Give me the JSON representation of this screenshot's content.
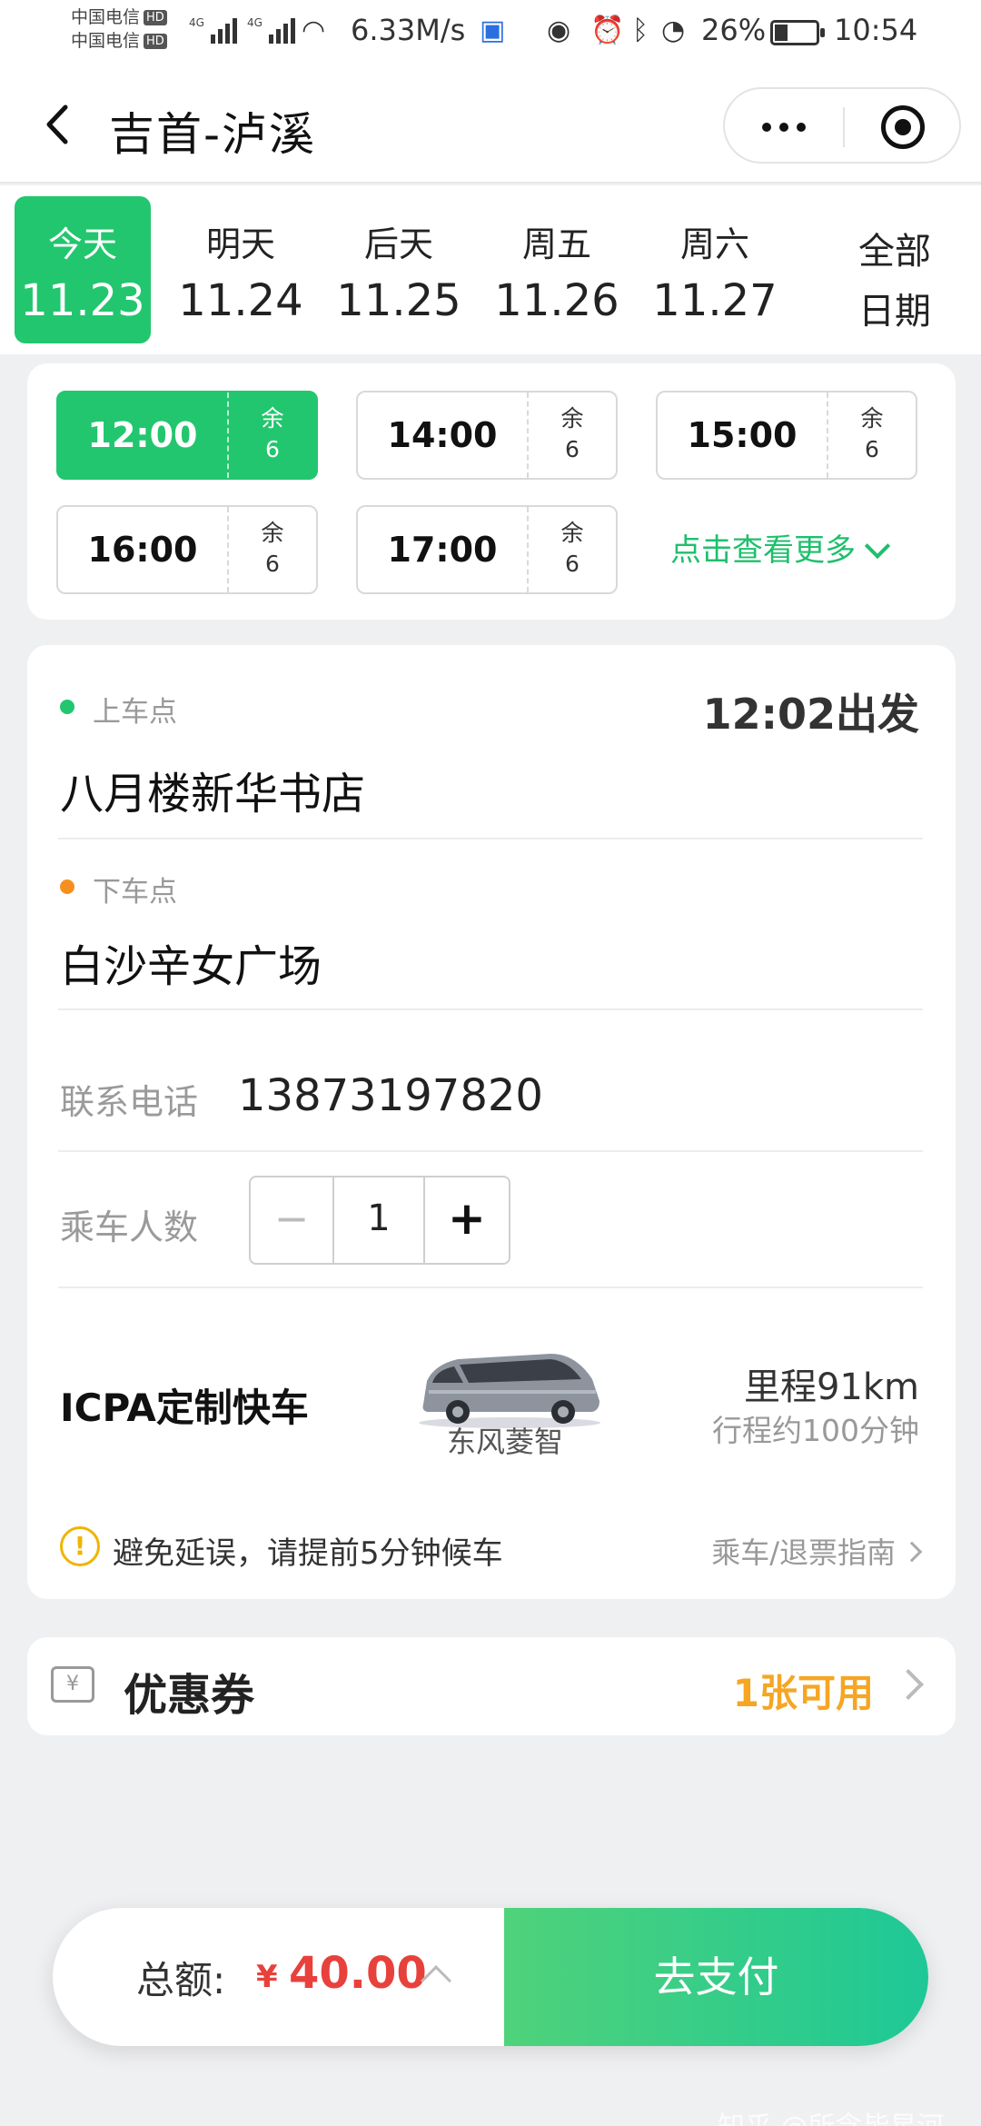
{
  "status": {
    "carrier1": "中国电信",
    "carrier2": "中国电信",
    "hd": "HD",
    "net": "4G",
    "speed": "6.33M/s",
    "battery": "26%",
    "time": "10:54"
  },
  "header": {
    "title": "吉首-泸溪",
    "back_icon": "chevron-left-icon",
    "more_icon": "more-icon",
    "close_icon": "target-icon"
  },
  "dates": [
    {
      "day": "今天",
      "date": "11.23"
    },
    {
      "day": "明天",
      "date": "11.24"
    },
    {
      "day": "后天",
      "date": "11.25"
    },
    {
      "day": "周五",
      "date": "11.26"
    },
    {
      "day": "周六",
      "date": "11.27"
    }
  ],
  "all_dates": {
    "line1": "全部",
    "line2": "日期"
  },
  "times": [
    {
      "time": "12:00",
      "rem": "余",
      "count": "6"
    },
    {
      "time": "14:00",
      "rem": "余",
      "count": "6"
    },
    {
      "time": "15:00",
      "rem": "余",
      "count": "6"
    },
    {
      "time": "16:00",
      "rem": "余",
      "count": "6"
    },
    {
      "time": "17:00",
      "rem": "余",
      "count": "6"
    }
  ],
  "more_times": "点击查看更多",
  "trip": {
    "pickup_label": "上车点",
    "departure": "12:02出发",
    "pickup": "八月楼新华书店",
    "dropoff_label": "下车点",
    "dropoff": "白沙辛女广场",
    "phone_label": "联系电话",
    "phone": "13873197820",
    "passengers_label": "乘车人数",
    "minus": "−",
    "passengers": "1",
    "plus": "+",
    "product": "ICPA定制快车",
    "vehicle": "东风菱智",
    "distance": "里程91km",
    "duration": "行程约100分钟",
    "notice": "避免延误，请提前5分钟候车",
    "guide": "乘车/退票指南"
  },
  "coupon": {
    "title": "优惠券",
    "available": "1张可用",
    "icon": "¥"
  },
  "pay": {
    "total_label": "总额:",
    "currency": "¥",
    "amount": "40.00",
    "button": "去支付"
  },
  "watermark": "知乎 @所念皆星河",
  "colors": {
    "accent": "#22c66e",
    "price": "#e8413c",
    "coupon": "#f5a623"
  }
}
